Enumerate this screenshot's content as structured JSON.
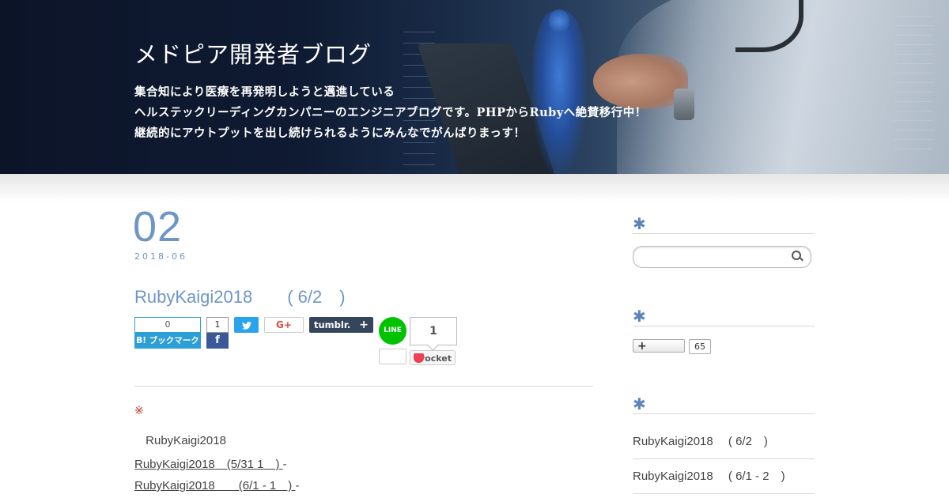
{
  "header": {
    "title": "メドピア開発者ブログ",
    "description": [
      "集合知により医療を再発明しようと邁進している",
      "ヘルステックリーディングカンパニーのエンジニアブログです。PHPからRubyへ絶賛移行中！",
      "継続的にアウトプットを出し続けられるようにみんなでがんばりまっす！"
    ]
  },
  "post": {
    "day": "02",
    "month": "2018-06",
    "title": "RubyKaigi2018　　( 6/2　)",
    "share": {
      "hatena_count": "0",
      "hatena_label": "B! ブックマーク",
      "facebook_count": "1",
      "facebook_label": "f",
      "twitter_label": "🐦",
      "gplus_label": "G+",
      "tumblr_label": "tumblr.",
      "tumblr_plus": "+",
      "line_label": "LINE",
      "pocket_count": "1",
      "pocket_label": "Pocket"
    },
    "note_mark": "※",
    "body_line": " RubyKaigi2018",
    "links": [
      {
        "text": "RubyKaigi2018　(5/31 1　)",
        "dash": "-"
      },
      {
        "text": "RubyKaigi2018　　(6/1 - 1　)",
        "dash": "-"
      }
    ]
  },
  "sidebar": {
    "heading_mark": "✱",
    "search_placeholder": "",
    "follow_label": "+",
    "follow_count": "65",
    "recent": [
      "RubyKaigi2018　 ( 6/2　)",
      "RubyKaigi2018　 ( 6/1 - 2　)"
    ]
  },
  "colors": {
    "accent": "#6d96c6",
    "hatena": "#2c9fd6",
    "facebook": "#3b5998",
    "twitter": "#2aa3ef",
    "tumblr": "#35465c",
    "line": "#00c300",
    "pocket": "#ef4056"
  }
}
